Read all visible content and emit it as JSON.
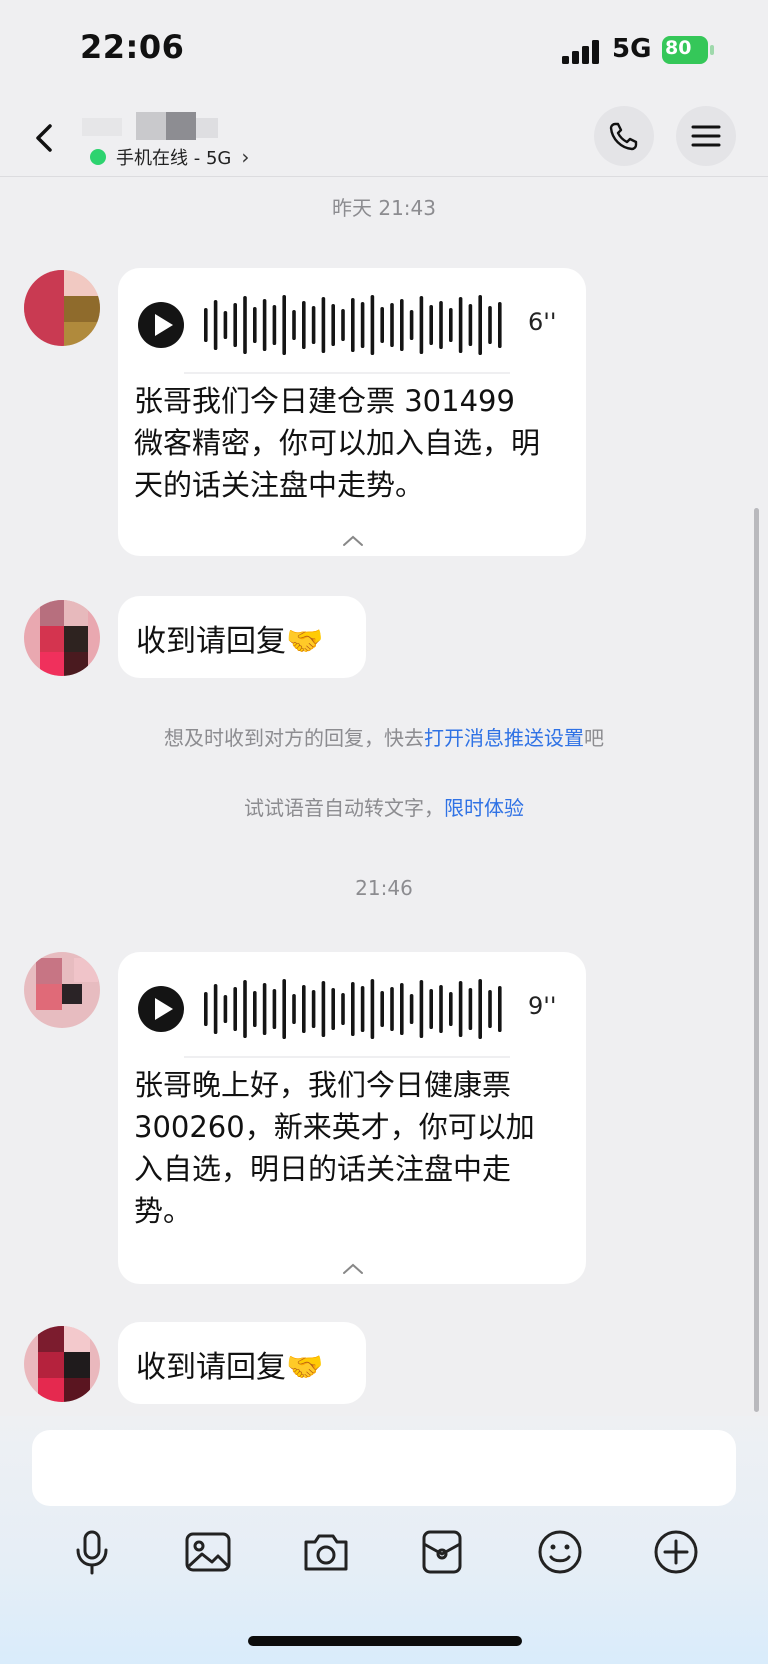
{
  "status_bar": {
    "time": "22:06",
    "network": "5G",
    "battery": "80",
    "battery_color": "#35c759"
  },
  "nav": {
    "online_status": "手机在线 - 5G",
    "online_color": "#2dd36f"
  },
  "icons": {
    "back": "chevron-left-icon",
    "phone": "phone-icon",
    "menu": "hamburger-menu-icon",
    "mic": "microphone-icon",
    "image": "image-icon",
    "camera": "camera-icon",
    "sticker": "sticker-icon",
    "emoji": "emoji-icon",
    "plus": "plus-circle-icon"
  },
  "messages": [
    {
      "timestamp": "昨天 21:43",
      "voice_duration": "6''",
      "transcript": "张哥我们今日建仓票 301499 微客精密，你可以加入自选，明天的话关注盘中走势。"
    },
    {
      "reply": "收到请回复🤝"
    },
    {
      "timestamp": "21:46",
      "voice_duration": "9''",
      "transcript": "张哥晚上好，我们今日健康票 300260，新来英才，你可以加入自选，明日的话关注盘中走势。"
    },
    {
      "reply": "收到请回复🤝"
    }
  ],
  "system_notices": {
    "push_prefix": "想及时收到对方的回复，快去",
    "push_link": "打开消息推送设置",
    "push_suffix": "吧",
    "voice_prefix": "试试语音自动转文字，",
    "voice_link": "限时体验"
  },
  "colors": {
    "link": "#2f72e5",
    "background": "#efeff1",
    "bubble": "#ffffff"
  }
}
